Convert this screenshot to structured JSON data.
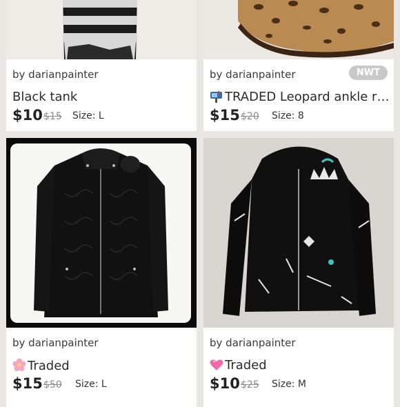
{
  "listings": [
    {
      "seller": "by darianpainter",
      "title": "Black tank",
      "price": "$10",
      "original_price": "$15",
      "size": "Size: L",
      "badge": ""
    },
    {
      "seller": "by darianpainter",
      "title": "TRADED Leopard ankle rai...",
      "title_icon": "mailbox-icon",
      "price": "$15",
      "original_price": "$20",
      "size": "Size: 8",
      "badge": "NWT"
    },
    {
      "seller": "by darianpainter",
      "title": "Traded",
      "title_icon": "cherry-blossom-icon",
      "price": "$15",
      "original_price": "$50",
      "size": "Size: L",
      "badge": ""
    },
    {
      "seller": "by darianpainter",
      "title": "Traded",
      "title_icon": "pink-heart-icon",
      "price": "$10",
      "original_price": "$25",
      "size": "Size: M",
      "badge": ""
    }
  ],
  "colors": {
    "background": "#e9e6e3",
    "card": "#ffffff",
    "badge": "#c9c9c9",
    "strike": "#8a8a8a"
  }
}
